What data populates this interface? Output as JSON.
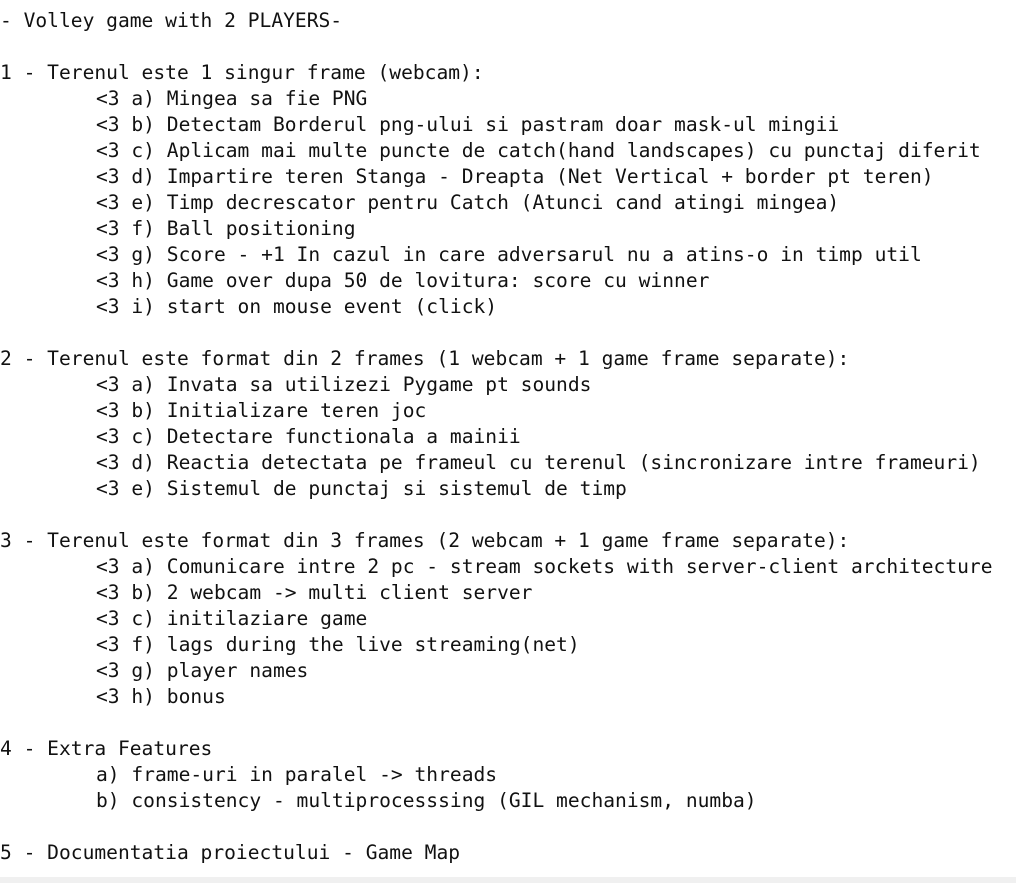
{
  "title": "- Volley game with 2 PLAYERS-",
  "sections": [
    {
      "heading": "1 - Terenul este 1 singur frame (webcam):",
      "items": [
        "<3 a) Mingea sa fie PNG",
        "<3 b) Detectam Borderul png-ului si pastram doar mask-ul mingii",
        "<3 c) Aplicam mai multe puncte de catch(hand landscapes) cu punctaj diferit",
        "<3 d) Impartire teren Stanga - Dreapta (Net Vertical + border pt teren)",
        "<3 e) Timp decrescator pentru Catch (Atunci cand atingi mingea)",
        "<3 f) Ball positioning",
        "<3 g) Score - +1 In cazul in care adversarul nu a atins-o in timp util",
        "<3 h) Game over dupa 50 de lovitura: score cu winner",
        "<3 i) start on mouse event (click)"
      ]
    },
    {
      "heading": "2 - Terenul este format din 2 frames (1 webcam + 1 game frame separate):",
      "items": [
        "<3 a) Invata sa utilizezi Pygame pt sounds",
        "<3 b) Initializare teren joc",
        "<3 c) Detectare functionala a mainii",
        "<3 d) Reactia detectata pe frameul cu terenul (sincronizare intre frameuri)",
        "<3 e) Sistemul de punctaj si sistemul de timp"
      ]
    },
    {
      "heading": "3 - Terenul este format din 3 frames (2 webcam + 1 game frame separate):",
      "items": [
        "<3 a) Comunicare intre 2 pc - stream sockets with server-client architecture",
        "<3 b) 2 webcam -> multi client server",
        "<3 c) initilaziare game",
        "<3 f) lags during the live streaming(net)",
        "<3 g) player names",
        "<3 h) bonus"
      ]
    },
    {
      "heading": "4 - Extra Features",
      "items": [
        "a) frame-uri in paralel -> threads",
        "b) consistency - multiprocesssing (GIL mechanism, numba)"
      ]
    },
    {
      "heading": "5 - Documentatia proiectului - Game Map",
      "items": []
    }
  ]
}
